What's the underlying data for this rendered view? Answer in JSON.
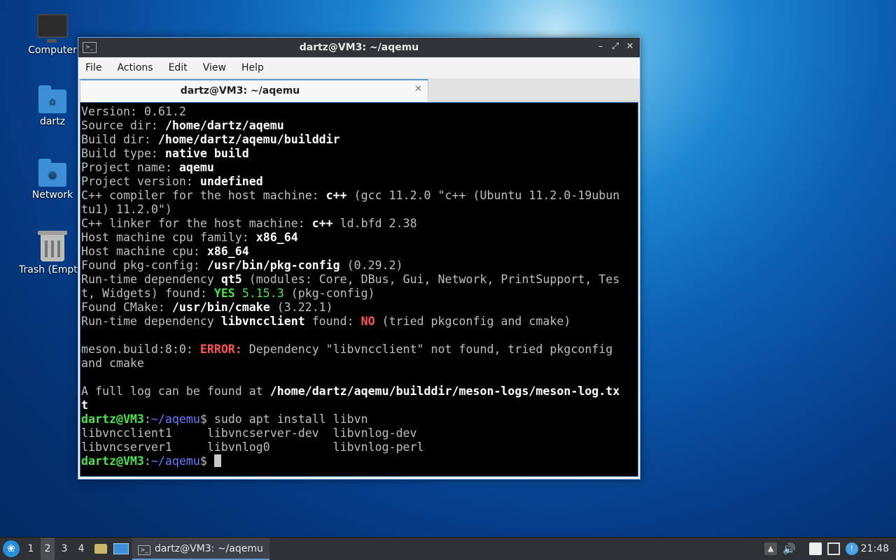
{
  "desktop": {
    "icons": [
      {
        "label": "Computer"
      },
      {
        "label": "dartz"
      },
      {
        "label": "Network"
      },
      {
        "label": "Trash (Empty)"
      }
    ]
  },
  "window": {
    "title": "dartz@VM3: ~/aqemu",
    "menu": [
      "File",
      "Actions",
      "Edit",
      "View",
      "Help"
    ],
    "tab_label": "dartz@VM3: ~/aqemu",
    "terminal": {
      "lines": [
        [
          {
            "t": "Version: 0.61.2"
          }
        ],
        [
          {
            "t": "Source dir: "
          },
          {
            "t": "/home/dartz/aqemu",
            "s": "b"
          }
        ],
        [
          {
            "t": "Build dir: "
          },
          {
            "t": "/home/dartz/aqemu/builddir",
            "s": "b"
          }
        ],
        [
          {
            "t": "Build type: "
          },
          {
            "t": "native build",
            "s": "b"
          }
        ],
        [
          {
            "t": "Project name: "
          },
          {
            "t": "aqemu",
            "s": "b"
          }
        ],
        [
          {
            "t": "Project version: "
          },
          {
            "t": "undefined",
            "s": "b"
          }
        ],
        [
          {
            "t": "C++ compiler for the host machine: "
          },
          {
            "t": "c++",
            "s": "b"
          },
          {
            "t": " (gcc 11.2.0 \"c++ (Ubuntu 11.2.0-19ubun"
          }
        ],
        [
          {
            "t": "tu1) 11.2.0\")"
          }
        ],
        [
          {
            "t": "C++ linker for the host machine: "
          },
          {
            "t": "c++",
            "s": "b"
          },
          {
            "t": " ld.bfd 2.38"
          }
        ],
        [
          {
            "t": "Host machine cpu family: "
          },
          {
            "t": "x86_64",
            "s": "b"
          }
        ],
        [
          {
            "t": "Host machine cpu: "
          },
          {
            "t": "x86_64",
            "s": "b"
          }
        ],
        [
          {
            "t": "Found pkg-config: "
          },
          {
            "t": "/usr/bin/pkg-config",
            "s": "b"
          },
          {
            "t": " (0.29.2)"
          }
        ],
        [
          {
            "t": "Run-time dependency "
          },
          {
            "t": "qt5",
            "s": "b"
          },
          {
            "t": " (modules: Core, DBus, Gui, Network, PrintSupport, Tes"
          }
        ],
        [
          {
            "t": "t, Widgets) found: "
          },
          {
            "t": "YES",
            "s": "grn"
          },
          {
            "t": " "
          },
          {
            "t": "5.15.3",
            "s": "grnn"
          },
          {
            "t": " (pkg-config)"
          }
        ],
        [
          {
            "t": "Found CMake: "
          },
          {
            "t": "/usr/bin/cmake",
            "s": "b"
          },
          {
            "t": " (3.22.1)"
          }
        ],
        [
          {
            "t": "Run-time dependency "
          },
          {
            "t": "libvncclient",
            "s": "b"
          },
          {
            "t": " found: "
          },
          {
            "t": "NO",
            "s": "red"
          },
          {
            "t": " (tried pkgconfig and cmake)"
          }
        ],
        [],
        [
          {
            "t": "meson.build:8:0: "
          },
          {
            "t": "ERROR:",
            "s": "red"
          },
          {
            "t": " Dependency \"libvncclient\" not found, tried pkgconfig"
          }
        ],
        [
          {
            "t": "and cmake"
          }
        ],
        [],
        [
          {
            "t": "A full log can be found at "
          },
          {
            "t": "/home/dartz/aqemu/builddir/meson-logs/meson-log.tx",
            "s": "b"
          }
        ],
        [
          {
            "t": "t",
            "s": "b"
          }
        ],
        [
          {
            "t": "dartz@VM3",
            "s": "grn"
          },
          {
            "t": ":"
          },
          {
            "t": "~/aqemu",
            "s": "blu"
          },
          {
            "t": "$ sudo apt install libvn"
          }
        ],
        [
          {
            "t": "libvncclient1     libvncserver-dev  libvnlog-dev"
          }
        ],
        [
          {
            "t": "libvncserver1     libvnlog0         libvnlog-perl"
          }
        ],
        [
          {
            "t": "dartz@VM3",
            "s": "grn"
          },
          {
            "t": ":"
          },
          {
            "t": "~/aqemu",
            "s": "blu"
          },
          {
            "t": "$ "
          }
        ]
      ]
    }
  },
  "taskbar": {
    "desktops": [
      "1",
      "2",
      "3",
      "4"
    ],
    "active_desktop": "2",
    "task_label": "dartz@VM3: ~/aqemu",
    "clock": "21:48",
    "tray_icons": [
      "up-arrow-icon",
      "volume-icon",
      "clipboard-icon",
      "network-icon",
      "update-notifier-icon"
    ]
  }
}
